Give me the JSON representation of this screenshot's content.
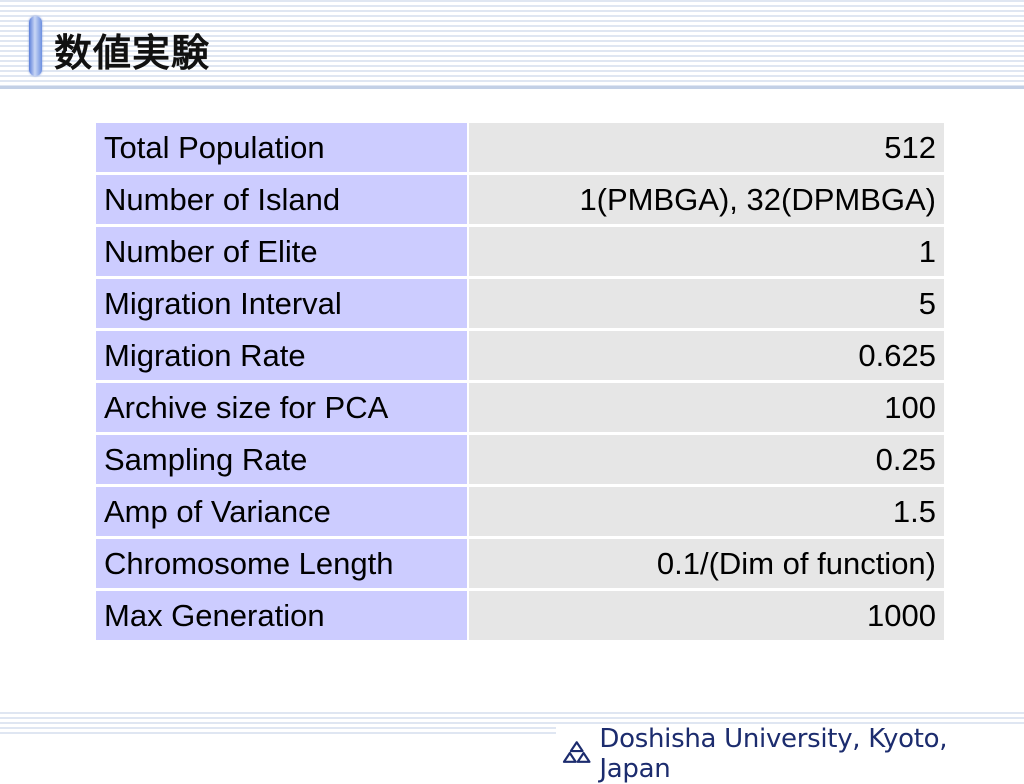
{
  "slide": {
    "title": "数値実験"
  },
  "table": {
    "rows": [
      {
        "label": "Total Population",
        "value": "512"
      },
      {
        "label": "Number of Island",
        "value": "1(PMBGA), 32(DPMBGA)"
      },
      {
        "label": "Number of Elite",
        "value": "1"
      },
      {
        "label": "Migration Interval",
        "value": "5"
      },
      {
        "label": "Migration Rate",
        "value": "0.625"
      },
      {
        "label": "Archive size for PCA",
        "value": "100"
      },
      {
        "label": "Sampling Rate",
        "value": "0.25"
      },
      {
        "label": "Amp of Variance",
        "value": "1.5"
      },
      {
        "label": "Chromosome Length",
        "value": "0.1/(Dim of function)"
      },
      {
        "label": "Max Generation",
        "value": "1000"
      }
    ]
  },
  "footer": {
    "text": "Doshisha University, Kyoto, Japan",
    "logo_icon": "doshisha-emblem-icon"
  },
  "colors": {
    "label_cell": "#ccccff",
    "value_cell": "#e6e6e6",
    "footer_text": "#1c2c6e",
    "stripe": "#dfe6f2"
  }
}
